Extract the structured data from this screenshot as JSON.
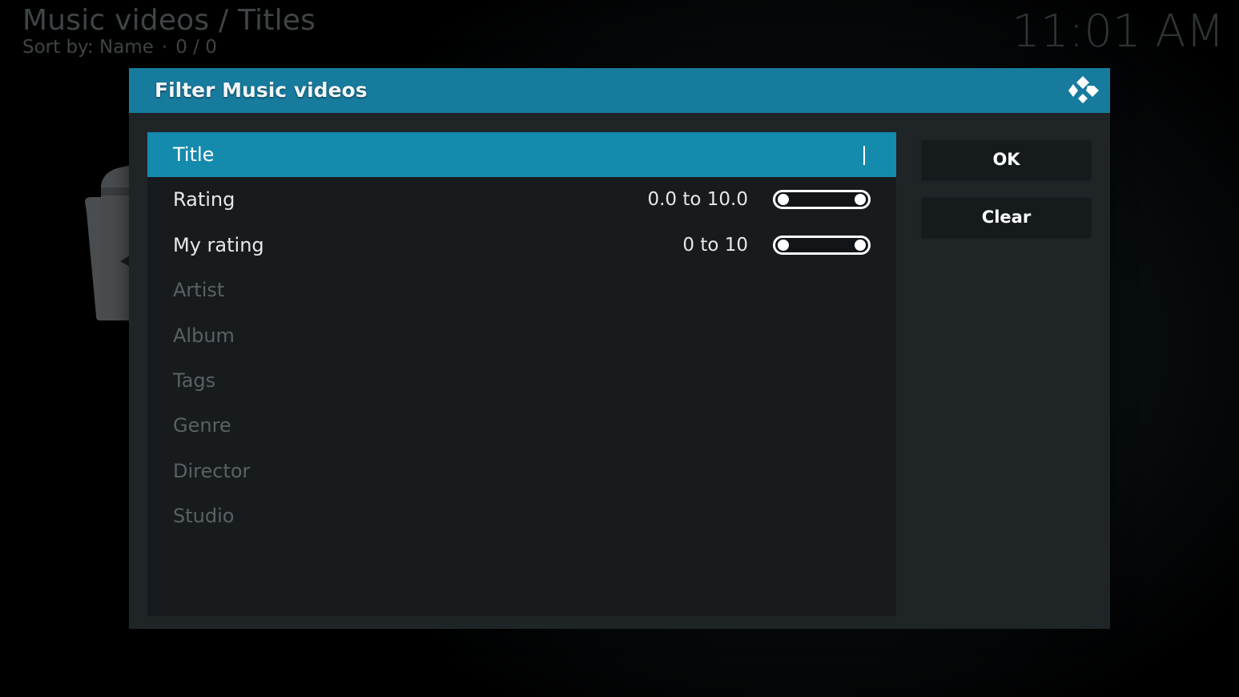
{
  "background": {
    "title": "Music videos / Titles",
    "sort_label": "Sort by: Name",
    "separator": "·",
    "count": "0 / 0",
    "clock": "11:01 AM"
  },
  "dialog": {
    "title": "Filter Music videos",
    "items": [
      {
        "label": "Title",
        "value": "",
        "state": "focused",
        "control": "text"
      },
      {
        "label": "Rating",
        "value": "0.0 to 10.0",
        "state": "enabled",
        "control": "range",
        "range": [
          0.0,
          10.0
        ],
        "min": 0,
        "max": 10
      },
      {
        "label": "My rating",
        "value": "0 to 10",
        "state": "enabled",
        "control": "range",
        "range": [
          0,
          10
        ],
        "min": 0,
        "max": 10
      },
      {
        "label": "Artist",
        "state": "disabled"
      },
      {
        "label": "Album",
        "state": "disabled"
      },
      {
        "label": "Tags",
        "state": "disabled"
      },
      {
        "label": "Genre",
        "state": "disabled"
      },
      {
        "label": "Director",
        "state": "disabled"
      },
      {
        "label": "Studio",
        "state": "disabled"
      }
    ],
    "buttons": {
      "ok": "OK",
      "clear": "Clear"
    }
  },
  "colors": {
    "header": "#177b9d",
    "focus": "#148aad",
    "panel": "#171b1d",
    "dialog": "#1f2427"
  },
  "icons": {
    "logo": "kodi-logo-icon",
    "background": "empty-library-icon"
  }
}
